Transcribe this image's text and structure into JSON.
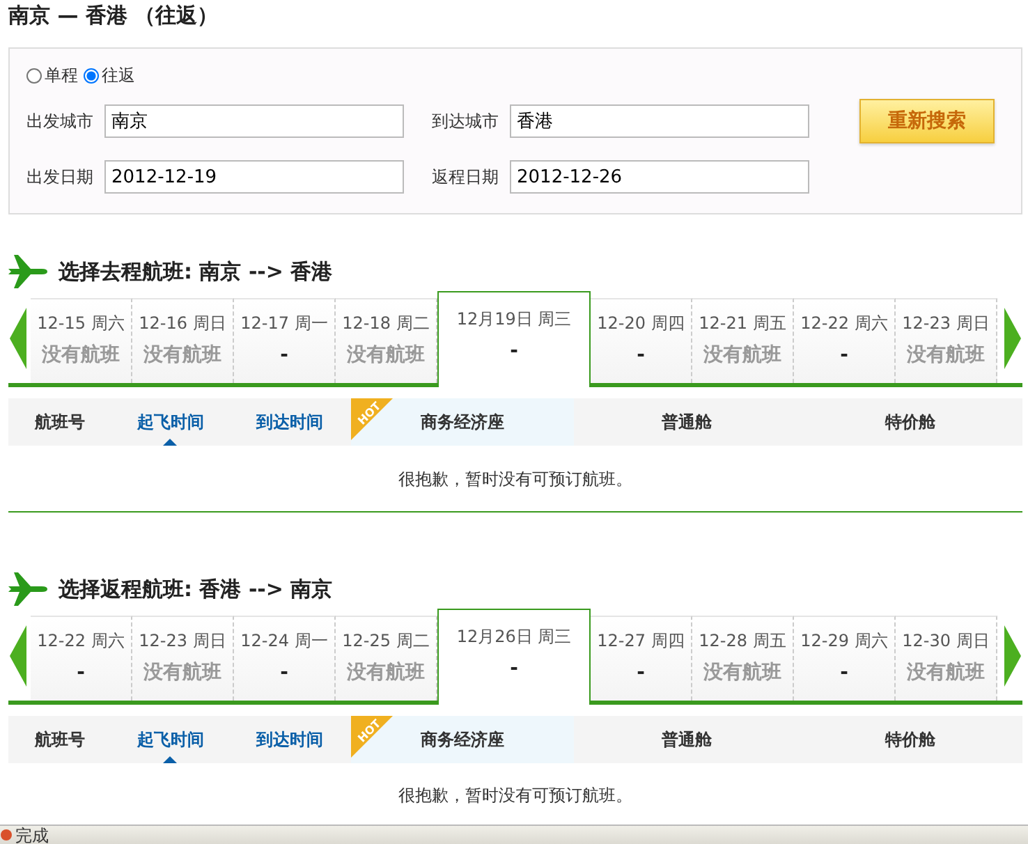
{
  "page_title": "南京 — 香港 （往返）",
  "search": {
    "trip_types": [
      {
        "label": "单程",
        "selected": false
      },
      {
        "label": "往返",
        "selected": true
      }
    ],
    "fields": [
      {
        "label": "出发城市",
        "value": "南京"
      },
      {
        "label": "到达城市",
        "value": "香港"
      },
      {
        "label": "出发日期",
        "value": "2012-12-19"
      },
      {
        "label": "返程日期",
        "value": "2012-12-26"
      }
    ],
    "search_button": "重新搜索"
  },
  "sections": [
    {
      "heading": "选择去程航班: 南京 --> 香港",
      "dates": [
        {
          "date": "12-15 周六",
          "status": "没有航班",
          "selected": false
        },
        {
          "date": "12-16 周日",
          "status": "没有航班",
          "selected": false
        },
        {
          "date": "12-17 周一",
          "status": "-",
          "selected": false
        },
        {
          "date": "12-18 周二",
          "status": "没有航班",
          "selected": false
        },
        {
          "date": "12月19日 周三",
          "status": "-",
          "selected": true
        },
        {
          "date": "12-20 周四",
          "status": "-",
          "selected": false
        },
        {
          "date": "12-21 周五",
          "status": "没有航班",
          "selected": false
        },
        {
          "date": "12-22 周六",
          "status": "-",
          "selected": false
        },
        {
          "date": "12-23 周日",
          "status": "没有航班",
          "selected": false
        }
      ],
      "columns": [
        {
          "label": "航班号",
          "sortable": false,
          "sorted": false
        },
        {
          "label": "起飞时间",
          "sortable": true,
          "sorted": true
        },
        {
          "label": "到达时间",
          "sortable": true,
          "sorted": false
        },
        {
          "label": "商务经济座",
          "sortable": false,
          "sorted": false,
          "badge": "HOT"
        },
        {
          "label": "普通舱",
          "sortable": false,
          "sorted": false
        },
        {
          "label": "特价舱",
          "sortable": false,
          "sorted": false
        }
      ],
      "message": "很抱歉，暂时没有可预订航班。"
    },
    {
      "heading": "选择返程航班: 香港 --> 南京",
      "dates": [
        {
          "date": "12-22 周六",
          "status": "-",
          "selected": false
        },
        {
          "date": "12-23 周日",
          "status": "没有航班",
          "selected": false
        },
        {
          "date": "12-24 周一",
          "status": "-",
          "selected": false
        },
        {
          "date": "12-25 周二",
          "status": "没有航班",
          "selected": false
        },
        {
          "date": "12月26日 周三",
          "status": "-",
          "selected": true
        },
        {
          "date": "12-27 周四",
          "status": "-",
          "selected": false
        },
        {
          "date": "12-28 周五",
          "status": "没有航班",
          "selected": false
        },
        {
          "date": "12-29 周六",
          "status": "-",
          "selected": false
        },
        {
          "date": "12-30 周日",
          "status": "没有航班",
          "selected": false
        }
      ],
      "columns": [
        {
          "label": "航班号",
          "sortable": false,
          "sorted": false
        },
        {
          "label": "起飞时间",
          "sortable": true,
          "sorted": true
        },
        {
          "label": "到达时间",
          "sortable": true,
          "sorted": false
        },
        {
          "label": "商务经济座",
          "sortable": false,
          "sorted": false,
          "badge": "HOT"
        },
        {
          "label": "普通舱",
          "sortable": false,
          "sorted": false
        },
        {
          "label": "特价舱",
          "sortable": false,
          "sorted": false
        }
      ],
      "message": "很抱歉，暂时没有可预订航班。"
    }
  ],
  "status_bar": "完成"
}
